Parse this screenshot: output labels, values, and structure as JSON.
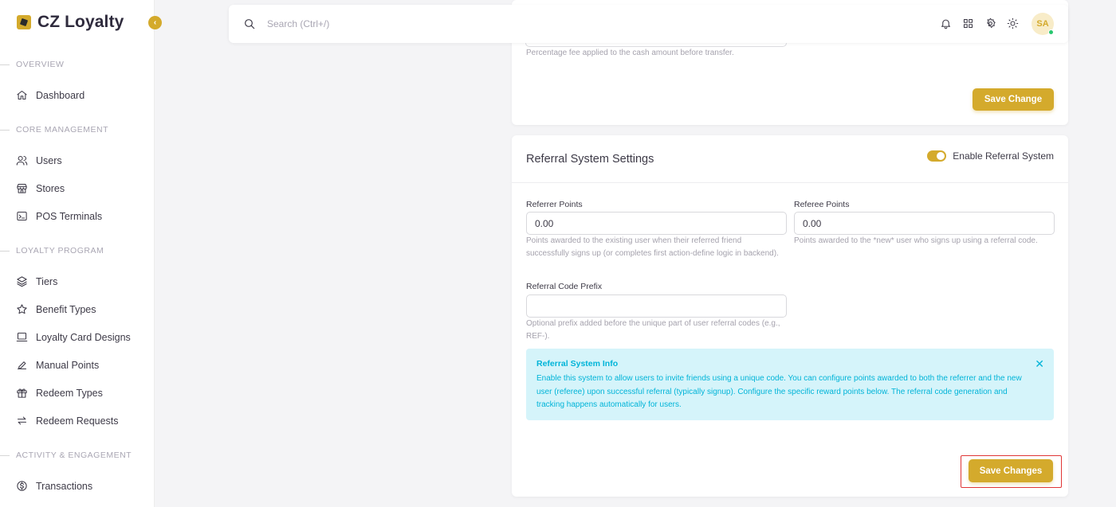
{
  "brand": {
    "name": "CZ Loyalty"
  },
  "sidebar": {
    "sections": [
      {
        "label": "OVERVIEW",
        "items": [
          {
            "label": "Dashboard",
            "icon": "home-icon"
          }
        ]
      },
      {
        "label": "CORE MANAGEMENT",
        "items": [
          {
            "label": "Users",
            "icon": "users-icon"
          },
          {
            "label": "Stores",
            "icon": "store-icon"
          },
          {
            "label": "POS Terminals",
            "icon": "terminal-icon"
          }
        ]
      },
      {
        "label": "LOYALTY PROGRAM",
        "items": [
          {
            "label": "Tiers",
            "icon": "layers-icon"
          },
          {
            "label": "Benefit Types",
            "icon": "star-icon"
          },
          {
            "label": "Loyalty Card Designs",
            "icon": "card-icon"
          },
          {
            "label": "Manual Points",
            "icon": "pencil-icon"
          },
          {
            "label": "Redeem Types",
            "icon": "gift-icon"
          },
          {
            "label": "Redeem Requests",
            "icon": "swap-icon"
          }
        ]
      },
      {
        "label": "ACTIVITY & ENGAGEMENT",
        "items": [
          {
            "label": "Transactions",
            "icon": "dollar-icon"
          }
        ]
      }
    ]
  },
  "topbar": {
    "search_placeholder": "Search (Ctrl+/)",
    "avatar_initials": "SA"
  },
  "top_card": {
    "help_text": "Percentage fee applied to the cash amount before transfer.",
    "save_label": "Save Change"
  },
  "referral_card": {
    "title": "Referral System Settings",
    "toggle_label": "Enable Referral System",
    "toggle_on": true,
    "referrer": {
      "label": "Referrer Points",
      "value": "0.00",
      "help": "Points awarded to the existing user when their referred friend successfully signs up (or completes first action-define logic in backend)."
    },
    "referee": {
      "label": "Referee Points",
      "value": "0.00",
      "help": "Points awarded to the *new* user who signs up using a referral code."
    },
    "prefix": {
      "label": "Referral Code Prefix",
      "value": "",
      "help": "Optional prefix added before the unique part of user referral codes (e.g., REF-)."
    },
    "info": {
      "title": "Referral System Info",
      "text": "Enable this system to allow users to invite friends using a unique code. You can configure points awarded to both the referrer and the new user (referee) upon successful referral (typically signup). Configure the specific reward points below. The referral code generation and tracking happens automatically for users."
    },
    "save_label": "Save Changes"
  },
  "colors": {
    "accent": "#d4aa2c",
    "info_bg": "#d5f4fa",
    "info_text": "#00b4d8",
    "highlight": "#e03535"
  }
}
